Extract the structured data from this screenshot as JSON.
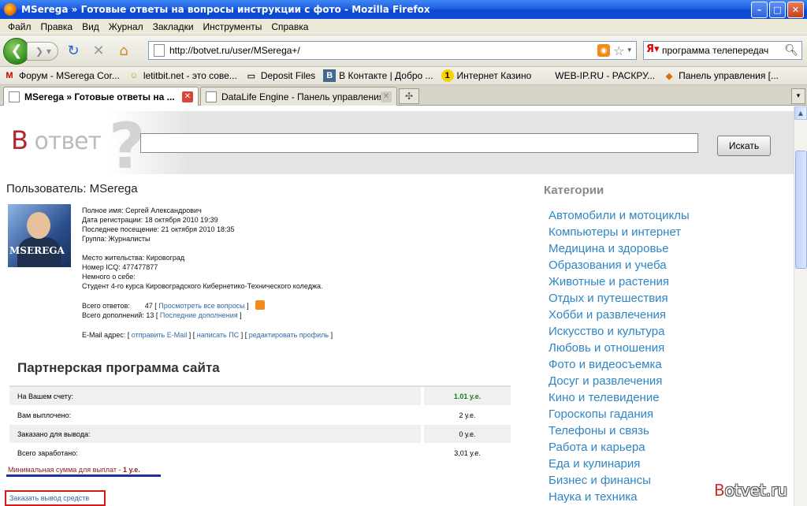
{
  "window": {
    "title": "MSerega » Готовые ответы на вопросы инструкции с фото - Mozilla Firefox",
    "buttons": {
      "minimize": "–",
      "maximize": "□",
      "close": "✕"
    }
  },
  "menu": [
    "Файл",
    "Правка",
    "Вид",
    "Журнал",
    "Закладки",
    "Инструменты",
    "Справка"
  ],
  "nav": {
    "url": "http://botvet.ru/user/MSerega+/",
    "search_value": "программа телепередач"
  },
  "bookmarks": [
    {
      "icon": "M",
      "label": "Форум - MSerega Cor..."
    },
    {
      "icon": "☺",
      "label": "letitbit.net - это сове..."
    },
    {
      "icon": "▭",
      "label": "Deposit Files"
    },
    {
      "icon": "B",
      "label": "В Контакте | Добро ..."
    },
    {
      "icon": "1",
      "label": "Интернет Казино"
    },
    {
      "icon": "",
      "label": "WEB-IP.RU - РАСКРУ..."
    },
    {
      "icon": "◆",
      "label": "Панель управления [..."
    }
  ],
  "tabs": [
    {
      "label": "MSerega » Готовые ответы на ...",
      "active": true
    },
    {
      "label": "DataLife Engine - Панель управления",
      "active": false
    }
  ],
  "site": {
    "logo_b": "В",
    "logo_rest": " ответ",
    "search_button": "Искать",
    "user_title": "Пользователь: MSerega",
    "avatar_name": "MSEREGA",
    "profile": {
      "full_name": "Полное имя: Сергей Александрович",
      "registered": "Дата регистрации: 18 октября 2010 19:39",
      "last_visit": "Последнее посещение: 21 октября 2010 18:35",
      "group": "Группа: Журналисты",
      "location": "Место жительства: Кировоград",
      "icq": "Номер ICQ: 477477877",
      "about_label": "Немного о себе:",
      "about_text": "Студент 4-го курса Кировоградского Кибернетико-Технического коледжа.",
      "answers_label": "Всего ответов:",
      "answers_count": "47",
      "answers_link": "Просмотреть все вопросы",
      "additions_label": "Всего дополнений:",
      "additions_count": "13",
      "additions_link": "Последние дополнения",
      "email_label": "E-Mail адрес:",
      "email_link": "отправить E-Mail",
      "pm_link": "написать ПС",
      "edit_link": "редактировать профиль"
    },
    "partner": {
      "title": "Партнерская программа сайта",
      "rows": [
        {
          "label": "На Вашем счету:",
          "value": "1.01 у.е."
        },
        {
          "label": "Вам выплочено:",
          "value": "2 у.е."
        },
        {
          "label": "Заказано для вывода:",
          "value": "0 у.е."
        },
        {
          "label": "Всего заработано:",
          "value": "3,01 у.е."
        }
      ],
      "min_sum_label": "Минимальная сумма для выплат - ",
      "min_sum_value": "1 у.е.",
      "order_link": "Заказать вывод средств"
    },
    "categories_title": "Категории",
    "categories": [
      "Автомобили и мотоциклы",
      "Компьютеры и интернет",
      "Медицина и здоровье",
      "Образования и учеба",
      "Животные и растения",
      "Отдых и путешествия",
      "Хобби и развлечения",
      "Искусство и культура",
      "Любовь и отношения",
      "Фото и видеосъемка",
      "Досуг и развлечения",
      "Кино и телевидение",
      "Гороскопы гадания",
      "Телефоны и связь",
      "Работа и карьера",
      "Еда и кулинария",
      "Бизнес и финансы",
      "Наука и техника"
    ],
    "watermark_b": "B",
    "watermark_rest": "otvet.ru"
  }
}
